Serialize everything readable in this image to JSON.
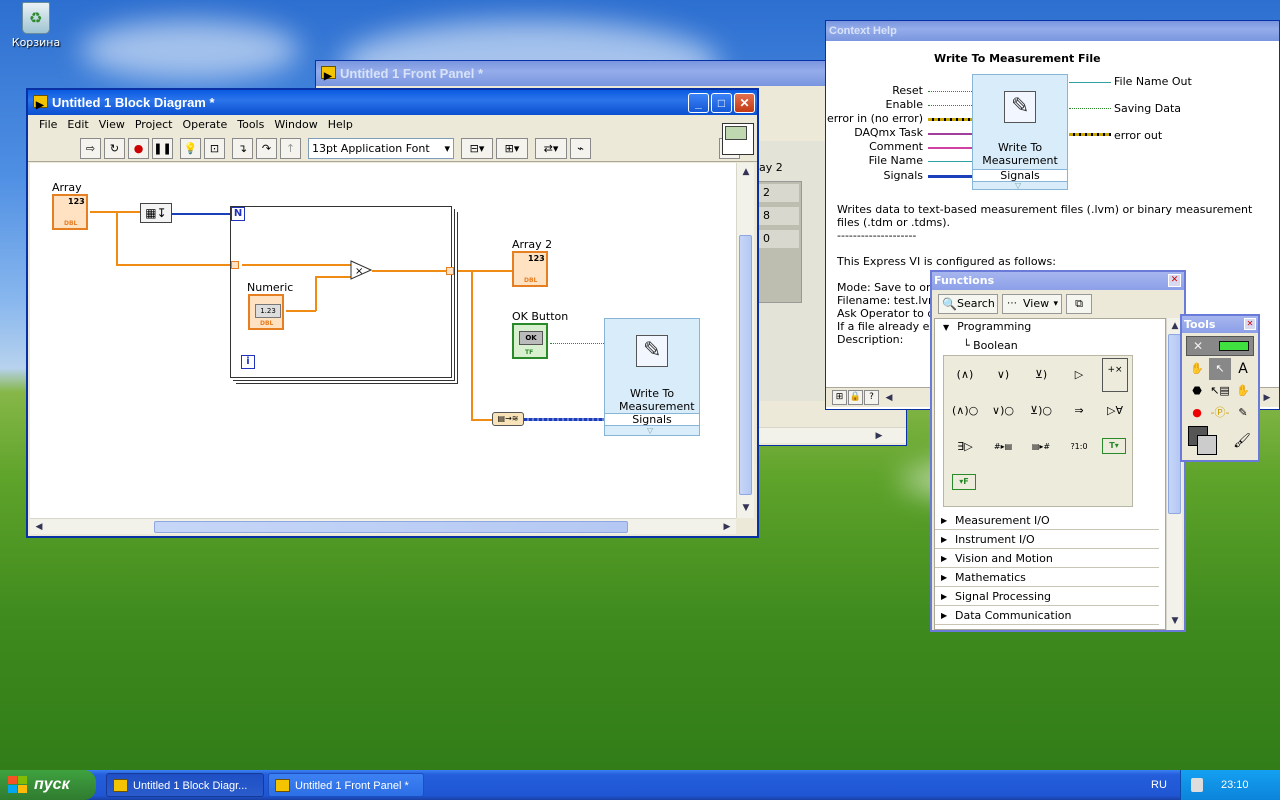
{
  "desktop": {
    "recycle_bin_label": "Корзина"
  },
  "front_panel": {
    "title": "Untitled 1 Front Panel *",
    "array2_partial_label": "ay 2",
    "array_values": [
      "2",
      "8",
      "0"
    ]
  },
  "block_diagram": {
    "title": "Untitled 1 Block Diagram *",
    "menu": [
      "File",
      "Edit",
      "View",
      "Project",
      "Operate",
      "Tools",
      "Window",
      "Help"
    ],
    "font_select": "13pt Application Font",
    "labels": {
      "array": "Array",
      "array2": "Array 2",
      "numeric": "Numeric",
      "ok_button": "OK Button",
      "loop_count": "N",
      "loop_iter": "i",
      "dbl": "DBL",
      "tf": "TF",
      "ok_text": "OK",
      "numeric_value": "1.23",
      "array_index": "123"
    },
    "express_vi": {
      "title": "Write To Measurement File",
      "terminal": "Signals"
    }
  },
  "context_help": {
    "title": "Context Help",
    "heading": "Write To Measurement File",
    "inputs": [
      "Reset",
      "Enable",
      "error in (no error)",
      "DAQmx Task",
      "Comment",
      "File Name",
      "Signals"
    ],
    "outputs": [
      "File Name Out",
      "Saving Data",
      "error out"
    ],
    "node_title": "Write To Measurement File",
    "node_terminal": "Signals",
    "description": "Writes data to text-based measurement files (.lvm) or binary measurement files (.tdm or .tdms).",
    "separator": "--------------------",
    "config_intro": "This Express VI is configured as follows:",
    "config_lines": [
      "Mode: Save to one",
      "Filename: test.lvm",
      "Ask Operator to ch",
      "If a file already exis",
      "Description:"
    ]
  },
  "functions_palette": {
    "title": "Functions",
    "search_label": "Search",
    "view_label": "View",
    "programming": "Programming",
    "boolean": "Boolean",
    "categories": [
      "Measurement I/O",
      "Instrument I/O",
      "Vision and Motion",
      "Mathematics",
      "Signal Processing",
      "Data Communication"
    ]
  },
  "tools_palette": {
    "title": "Tools"
  },
  "taskbar": {
    "start_label": "пуск",
    "tasks": [
      "Untitled 1 Block Diagr...",
      "Untitled 1 Front Panel *"
    ],
    "language": "RU",
    "clock": "23:10"
  },
  "colors": {
    "wire_numeric": "#f08c14",
    "wire_integer": "#1a3fb8",
    "xp_titlebar": "#0a5ae0"
  }
}
